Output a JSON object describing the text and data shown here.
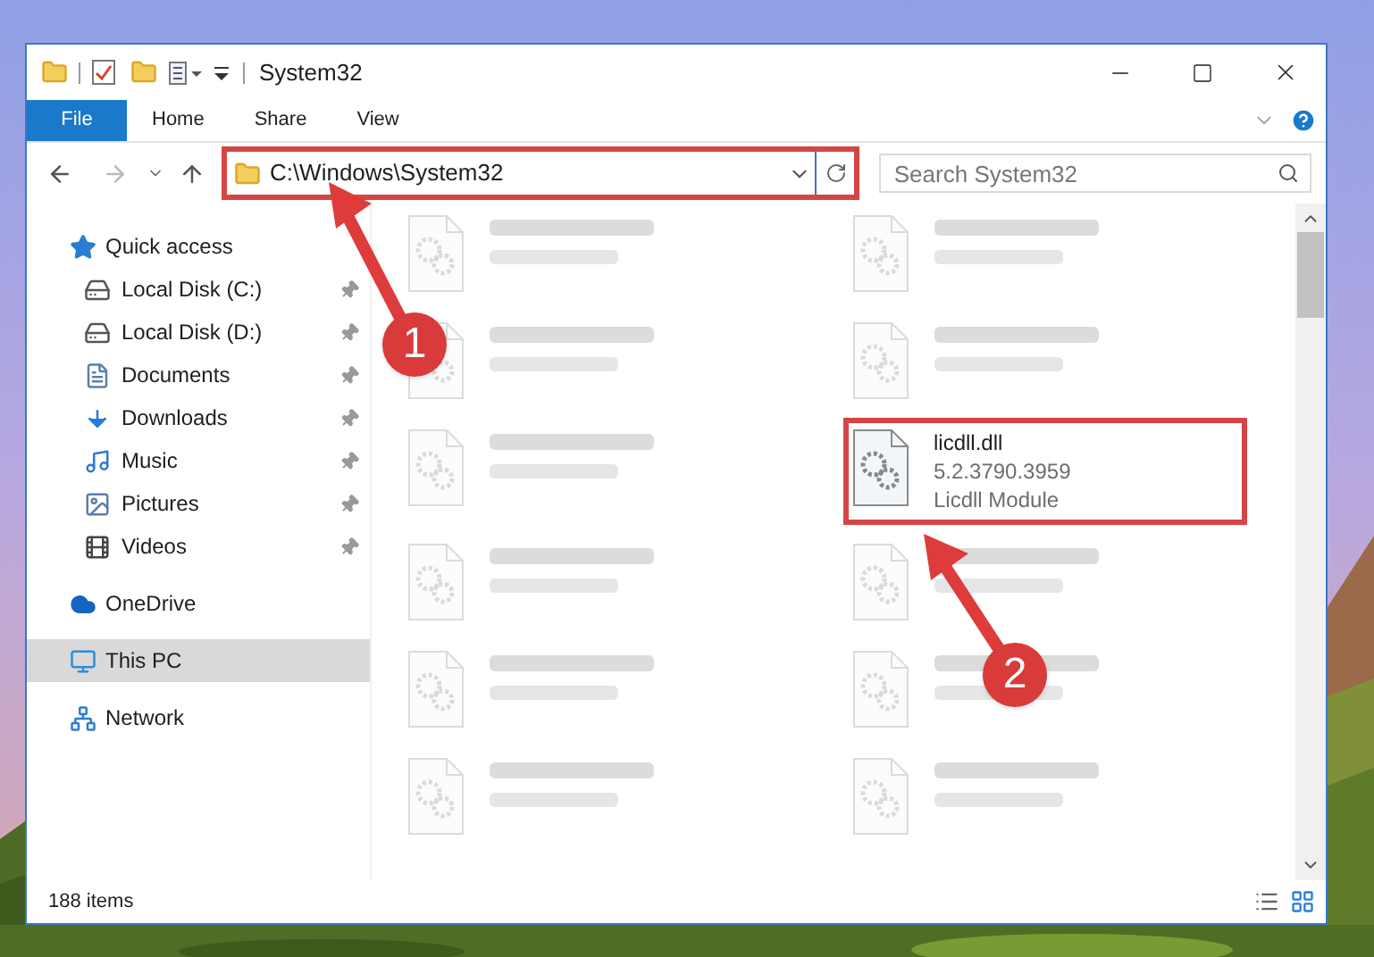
{
  "window": {
    "title": "System32"
  },
  "ribbon_tabs": [
    {
      "label": "File",
      "kind": "file"
    },
    {
      "label": "Home",
      "kind": "tab"
    },
    {
      "label": "Share",
      "kind": "tab"
    },
    {
      "label": "View",
      "kind": "tab"
    }
  ],
  "address": {
    "path": "C:\\Windows\\System32"
  },
  "search": {
    "placeholder": "Search System32"
  },
  "sidebar": {
    "items": [
      {
        "label": "Quick access",
        "kind": "star",
        "selected": false,
        "children": [
          {
            "label": "Local Disk (C:)",
            "kind": "system-disk",
            "pinned": true
          },
          {
            "label": "Local Disk (D:)",
            "kind": "disk",
            "pinned": true
          },
          {
            "label": "Documents",
            "kind": "documents",
            "pinned": true
          },
          {
            "label": "Downloads",
            "kind": "downloads",
            "pinned": true
          },
          {
            "label": "Music",
            "kind": "music",
            "pinned": true
          },
          {
            "label": "Pictures",
            "kind": "pictures",
            "pinned": true
          },
          {
            "label": "Videos",
            "kind": "videos",
            "pinned": true
          }
        ]
      },
      {
        "label": "OneDrive",
        "kind": "cloud",
        "selected": false
      },
      {
        "label": "This PC",
        "kind": "pc",
        "selected": true
      },
      {
        "label": "Network",
        "kind": "network",
        "selected": false
      }
    ]
  },
  "files": [
    {
      "kind": "blurred"
    },
    {
      "kind": "blurred"
    },
    {
      "kind": "blurred"
    },
    {
      "kind": "blurred"
    },
    {
      "kind": "blurred"
    },
    {
      "kind": "highlighted",
      "name": "licdll.dll",
      "lines": [
        "5.2.3790.3959",
        "Licdll Module"
      ]
    },
    {
      "kind": "blurred"
    },
    {
      "kind": "blurred"
    },
    {
      "kind": "blurred"
    },
    {
      "kind": "blurred"
    },
    {
      "kind": "blurred"
    },
    {
      "kind": "blurred"
    }
  ],
  "status_bar": {
    "count": "188 items"
  },
  "annotations": [
    {
      "label": "1"
    },
    {
      "label": "2"
    }
  ]
}
